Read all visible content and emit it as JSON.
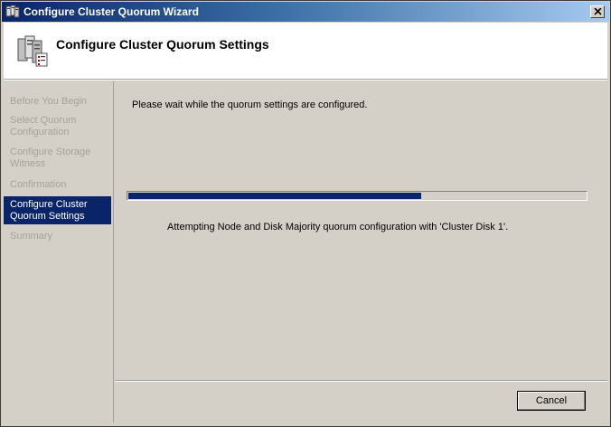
{
  "window": {
    "title": "Configure Cluster Quorum Wizard",
    "icon": "cluster-icon",
    "close_label": "close-icon"
  },
  "header": {
    "title": "Configure Cluster Quorum Settings",
    "icon": "cluster-servers-icon"
  },
  "steps": [
    {
      "label": "Before You Begin",
      "active": false
    },
    {
      "label": "Select Quorum Configuration",
      "active": false
    },
    {
      "label": "Configure Storage Witness",
      "active": false
    },
    {
      "label": "Confirmation",
      "active": false
    },
    {
      "label": "Configure Cluster Quorum Settings",
      "active": true
    },
    {
      "label": "Summary",
      "active": false
    }
  ],
  "content": {
    "message": "Please wait while the quorum settings are configured.",
    "progress": 0.64,
    "status": "Attempting Node and Disk Majority quorum configuration with 'Cluster Disk 1'."
  },
  "buttons": {
    "cancel": "Cancel"
  },
  "colors": {
    "accent": "#0a246a",
    "face": "#d4d0c8"
  }
}
